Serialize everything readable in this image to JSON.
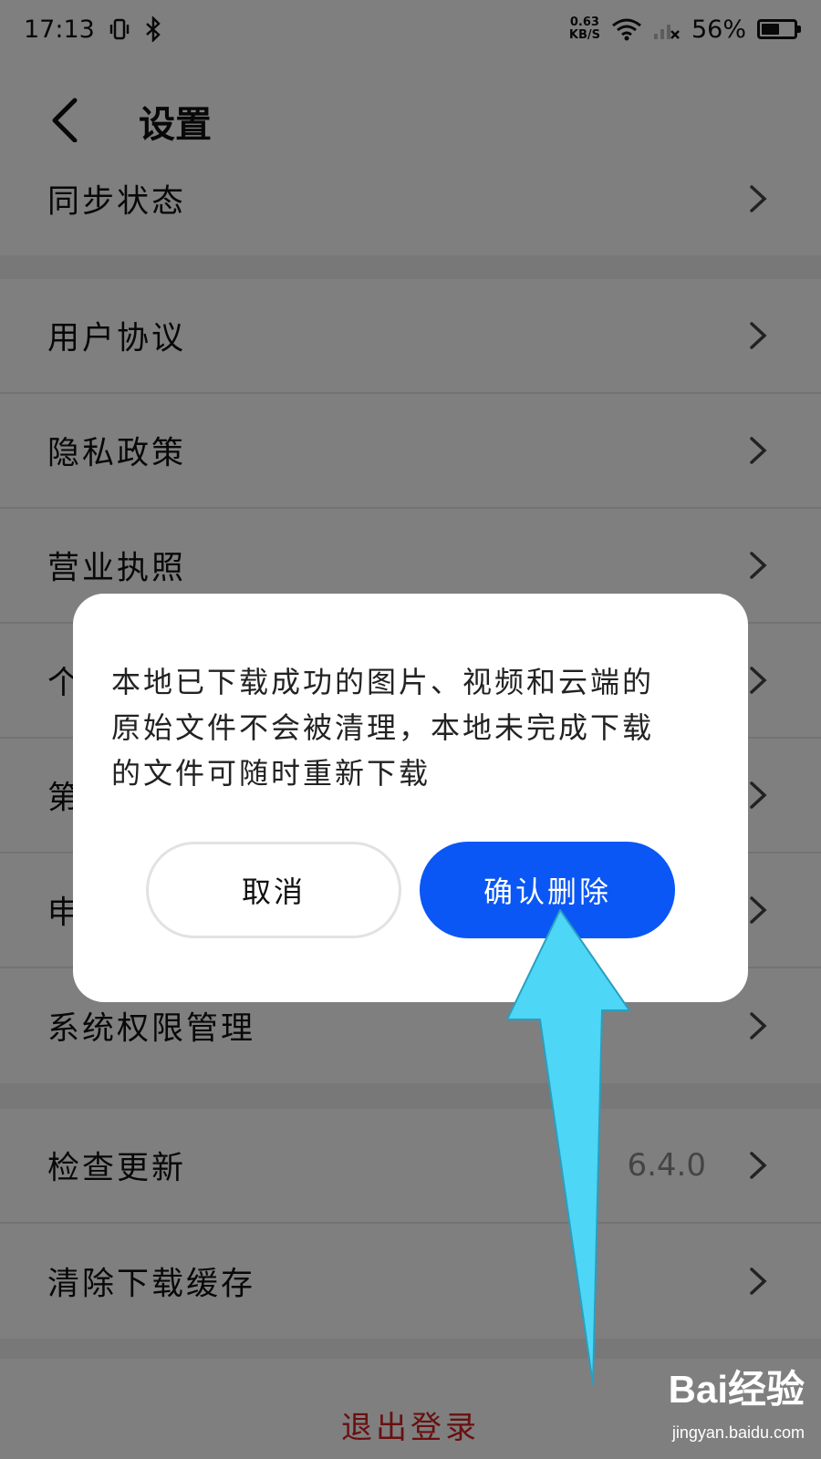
{
  "status_bar": {
    "time": "17:13",
    "net_speed_value": "0.63",
    "net_speed_unit": "KB/S",
    "battery_percent": "56%",
    "battery_level": 0.56
  },
  "header": {
    "title": "设置"
  },
  "sections": [
    {
      "items": [
        {
          "label": "同步状态"
        }
      ]
    },
    {
      "items": [
        {
          "label": "用户协议"
        },
        {
          "label": "隐私政策"
        },
        {
          "label": "营业执照"
        },
        {
          "label": "个"
        },
        {
          "label": "第"
        },
        {
          "label": "申"
        },
        {
          "label": "系统权限管理"
        }
      ]
    },
    {
      "items": [
        {
          "label": "检查更新",
          "value": "6.4.0"
        },
        {
          "label": "清除下载缓存"
        }
      ]
    }
  ],
  "logout_label": "退出登录",
  "dialog": {
    "message_lines": [
      "本地已下载成功的图片、视频和云端的",
      "原始文件不会被清理，本地未完成下载",
      "的文件可随时重新下载"
    ],
    "cancel_label": "取消",
    "confirm_label": "确认删除"
  },
  "watermark": {
    "logo": "Bai经验",
    "url": "jingyan.baidu.com"
  },
  "colors": {
    "confirm_button": "#0a57f5",
    "logout_text": "#d32020",
    "annotation_arrow": "#4dd6f5"
  }
}
